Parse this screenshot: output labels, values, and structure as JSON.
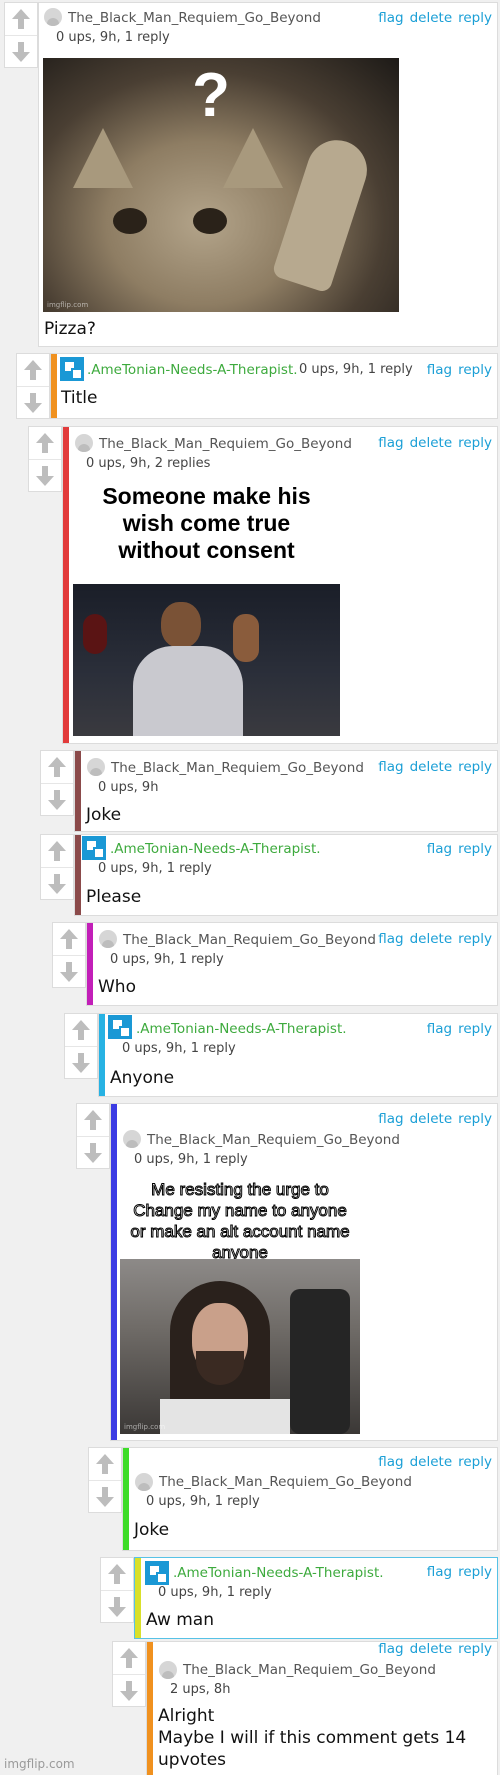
{
  "actions": {
    "flag": "flag",
    "delete": "delete",
    "reply": "reply"
  },
  "comments": [
    {
      "user": "The_Black_Man_Requiem_Go_Beyond",
      "meta": "0 ups, 9h, 1 reply",
      "text": "Pizza?",
      "image": {
        "subject": "confused-cat",
        "watermark": "imgflip.com",
        "caption": "?"
      }
    },
    {
      "user": ".AmeTonian-Needs-A-Therapist.",
      "meta": "0 ups, 9h, 1 reply",
      "text": "Title",
      "accent": "#f0911f"
    },
    {
      "user": "The_Black_Man_Requiem_Go_Beyond",
      "meta": "0 ups, 9h, 2 replies",
      "accent": "#e23b3b",
      "image": {
        "subject": "man-gesturing",
        "caption": "Someone make his wish come true without consent"
      }
    },
    {
      "user": "The_Black_Man_Requiem_Go_Beyond",
      "meta": "0 ups, 9h",
      "text": "Joke",
      "accent": "#8b4a4a"
    },
    {
      "user": ".AmeTonian-Needs-A-Therapist.",
      "meta": "0 ups, 9h, 1 reply",
      "text": "Please",
      "accent": "#8b4a4a"
    },
    {
      "user": "The_Black_Man_Requiem_Go_Beyond",
      "meta": "0 ups, 9h, 1 reply",
      "text": "Who",
      "accent": "#c21fb8"
    },
    {
      "user": ".AmeTonian-Needs-A-Therapist.",
      "meta": "0 ups, 9h, 1 reply",
      "text": "Anyone",
      "accent": "#27b2e3"
    },
    {
      "user": "The_Black_Man_Requiem_Go_Beyond",
      "meta": "0 ups, 9h, 1 reply",
      "accent": "#3b3be3",
      "image": {
        "subject": "long-haired-man",
        "watermark": "imgflip.com",
        "caption": "Me resisting the urge to Change my name to anyone or make an alt account name anyone"
      }
    },
    {
      "user": "The_Black_Man_Requiem_Go_Beyond",
      "meta": "0 ups, 9h, 1 reply",
      "text": "Joke",
      "accent": "#3ddc28"
    },
    {
      "user": ".AmeTonian-Needs-A-Therapist.",
      "meta": "0 ups, 9h, 1 reply",
      "text": "Aw man",
      "accent": "#d9e02a"
    },
    {
      "user": "The_Black_Man_Requiem_Go_Beyond",
      "meta": "2 ups, 8h",
      "accent": "#f0911f",
      "text_lines": [
        "Alright",
        "Maybe I will if this comment gets 14",
        "upvotes"
      ]
    }
  ],
  "footer": "imgflip.com",
  "colors": {
    "link": "#1b9fd6",
    "green_user": "#3daa3d",
    "selected_border": "#56c2e6"
  }
}
